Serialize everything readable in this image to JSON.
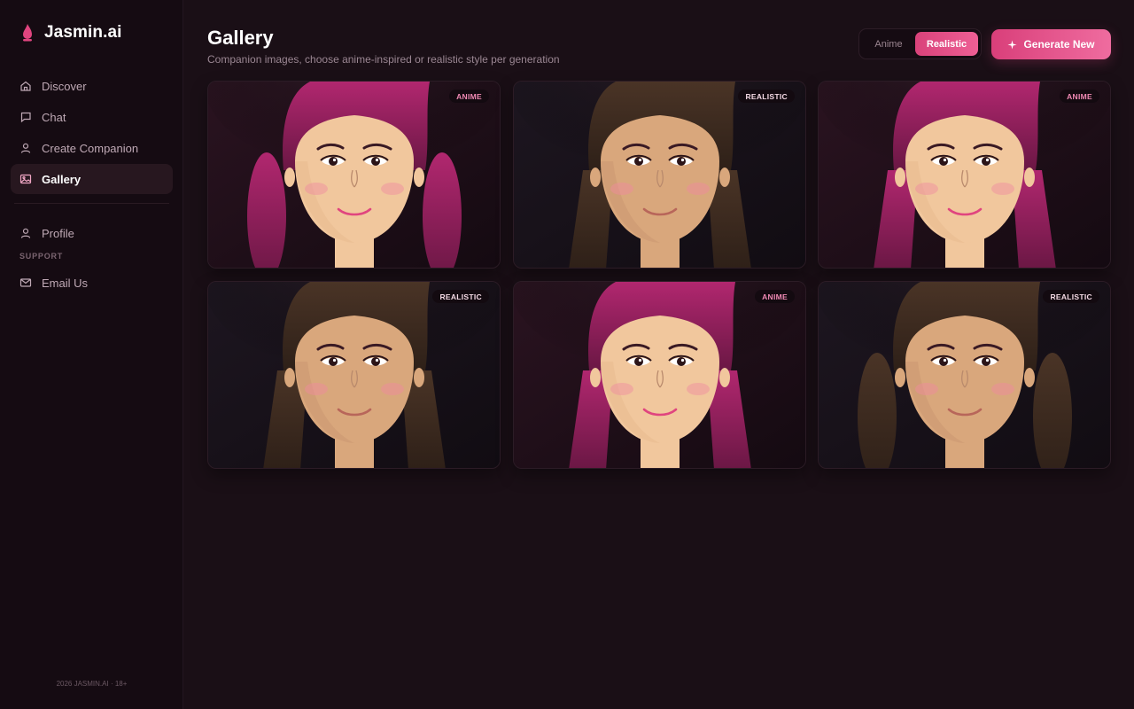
{
  "brand": {
    "name": "Jasmin.ai",
    "accent": "#e0457f"
  },
  "sidebar": {
    "items": [
      {
        "label": "Discover",
        "icon": "home-icon",
        "active": false
      },
      {
        "label": "Chat",
        "icon": "chat-bubble-icon",
        "active": false
      },
      {
        "label": "Create Companion",
        "icon": "user-icon",
        "active": false
      },
      {
        "label": "Gallery",
        "icon": "image-icon",
        "active": true
      }
    ],
    "secondary_items": [
      {
        "label": "Profile",
        "icon": "user-icon"
      }
    ],
    "support_heading": "SUPPORT",
    "support_items": [
      {
        "label": "Email Us",
        "icon": "mail-icon"
      }
    ],
    "footer": "2026 JASMIN.AI · 18+"
  },
  "header": {
    "title": "Gallery",
    "subtitle": "Companion images, choose anime-inspired or realistic style per generation",
    "style_toggle": {
      "options": [
        "Anime",
        "Realistic"
      ],
      "selected": "Realistic"
    },
    "generate_label": "Generate New",
    "generate_icon": "sparkle-icon"
  },
  "gallery": [
    {
      "style": "anime",
      "badge": "ANIME",
      "hair": "magenta",
      "hair_style": "long-round"
    },
    {
      "style": "realistic",
      "badge": "REALISTIC",
      "hair": "brown",
      "hair_style": "long-straight"
    },
    {
      "style": "anime",
      "badge": "ANIME",
      "hair": "magenta",
      "hair_style": "long-straight"
    },
    {
      "style": "realistic",
      "badge": "REALISTIC",
      "hair": "brown",
      "hair_style": "long-straight"
    },
    {
      "style": "anime",
      "badge": "ANIME",
      "hair": "magenta",
      "hair_style": "long-straight"
    },
    {
      "style": "realistic",
      "badge": "REALISTIC",
      "hair": "brown",
      "hair_style": "long-round"
    }
  ],
  "colors": {
    "background": "#1a0f16",
    "sidebar": "#150b12",
    "accent_start": "#d9427a",
    "accent_end": "#ee5f95",
    "hair_magenta": "#b1276f",
    "hair_brown": "#4a3426",
    "skin_anime": "#f1c79d",
    "skin_realistic": "#d9a77c"
  }
}
